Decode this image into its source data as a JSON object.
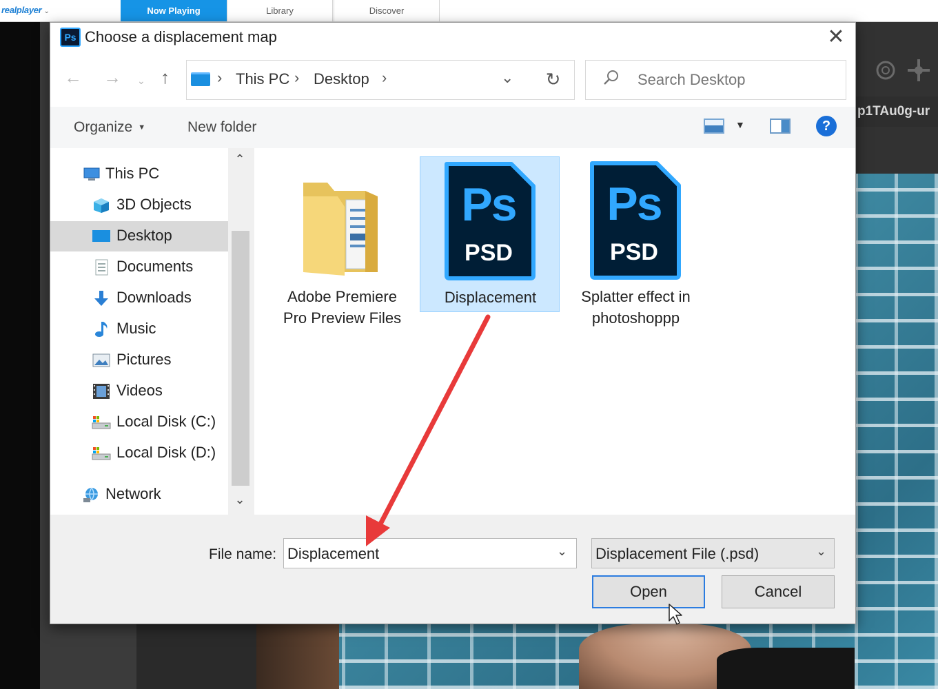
{
  "realplayer": {
    "logo": "realplayer",
    "tabs": [
      {
        "label": "Now Playing",
        "active": true
      },
      {
        "label": "Library",
        "active": false
      },
      {
        "label": "Discover",
        "active": false
      }
    ]
  },
  "background": {
    "tab_text": "p1TAu0g-ur"
  },
  "dialog": {
    "app_icon": "Ps",
    "title": "Choose a displacement map",
    "breadcrumb": [
      "This PC",
      "Desktop"
    ],
    "search_placeholder": "Search Desktop",
    "toolbar": {
      "organize": "Organize",
      "new_folder": "New folder"
    },
    "nav_items": [
      {
        "label": "This PC",
        "icon": "pc-icon",
        "indent": 0
      },
      {
        "label": "3D Objects",
        "icon": "cube-icon",
        "indent": 1
      },
      {
        "label": "Desktop",
        "icon": "desktop-icon",
        "indent": 1,
        "selected": true
      },
      {
        "label": "Documents",
        "icon": "documents-icon",
        "indent": 1
      },
      {
        "label": "Downloads",
        "icon": "download-arrow-icon",
        "indent": 1
      },
      {
        "label": "Music",
        "icon": "music-note-icon",
        "indent": 1
      },
      {
        "label": "Pictures",
        "icon": "pictures-icon",
        "indent": 1
      },
      {
        "label": "Videos",
        "icon": "film-icon",
        "indent": 1
      },
      {
        "label": "Local Disk (C:)",
        "icon": "disk-icon",
        "indent": 1
      },
      {
        "label": "Local Disk (D:)",
        "icon": "disk-icon",
        "indent": 1
      },
      {
        "label": "Network",
        "icon": "network-icon",
        "indent": 0
      }
    ],
    "files": [
      {
        "label_line1": "Adobe Premiere",
        "label_line2": "Pro Preview Files",
        "type": "folder",
        "selected": false
      },
      {
        "label_line1": "Displacement",
        "label_line2": "",
        "type": "psd",
        "selected": true,
        "badge_top": "Ps",
        "badge_bottom": "PSD"
      },
      {
        "label_line1": "Splatter effect in",
        "label_line2": "photoshoppp",
        "type": "psd",
        "selected": false,
        "badge_top": "Ps",
        "badge_bottom": "PSD"
      }
    ],
    "file_name_label": "File name:",
    "file_name_value": "Displacement",
    "file_type_value": "Displacement File (.psd)",
    "open_label": "Open",
    "cancel_label": "Cancel"
  },
  "colors": {
    "accent": "#1694e6",
    "annotation_arrow": "#e83a3a",
    "psd_blue": "#31a8ff",
    "psd_dark": "#001e36"
  }
}
